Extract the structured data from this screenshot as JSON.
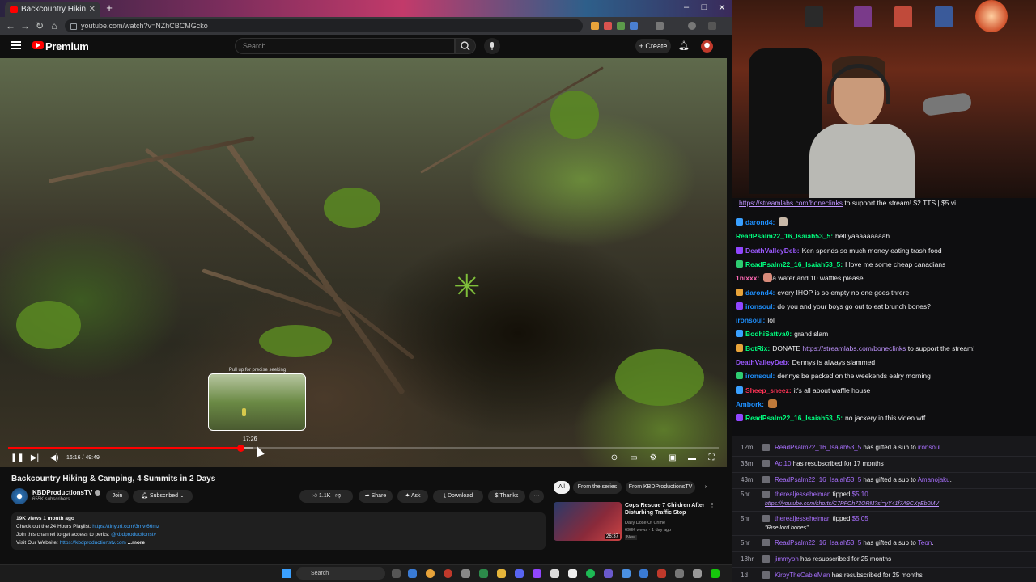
{
  "browser": {
    "tab_title": "Backcountry Hiking & Camp",
    "url": "youtube.com/watch?v=NZhCBCMGcko"
  },
  "youtube": {
    "brand": "Premium",
    "search_placeholder": "Search",
    "create_label": "Create",
    "video": {
      "hint": "Pull up for precise seeking",
      "preview_time": "17:26",
      "time_display": "16:16 / 49:49",
      "played_fraction": 0.327,
      "buffered_fraction": 0.345,
      "title": "Backcountry Hiking & Camping, 4 Summits in 2 Days"
    },
    "channel": {
      "name": "KBDProductionsTV",
      "subscribers": "655K subscribers",
      "join_label": "Join",
      "subscribed_label": "Subscribed"
    },
    "actions": {
      "likes": "1.1K",
      "share": "Share",
      "ask": "Ask",
      "download": "Download",
      "thanks": "Thanks",
      "more": "···"
    },
    "description": {
      "meta": "19K views  1 month ago",
      "line1_text": "Check out the 24 Hours Playlist: ",
      "line1_link": "https://tinyurl.com/3mvt66mz",
      "line2_text": "Join this channel to get access to perks: ",
      "line2_link": "@kbdproductionstv",
      "line3_text": "Visit Our Website: ",
      "line3_link": "https://kbdproductionstv.com",
      "more": "...more"
    },
    "filters": [
      "All",
      "From the series",
      "From KBDProductionsTV"
    ],
    "upnext": {
      "title": "Cops Rescue 7 Children After Disturbing Traffic Stop",
      "channel": "Daily Dose Of Crime",
      "meta": "698K views · 1 day ago",
      "badge": "New",
      "duration": "26:37"
    }
  },
  "taskbar": {
    "search_label": "Search"
  },
  "chat": {
    "banner_link": "https://streamlabs.com/boneclinks",
    "banner_text": " to support the stream! $2 TTS | $5 vi...",
    "messages": [
      {
        "user": "darond4:",
        "text": "",
        "color": "#1e90ff",
        "emote": "#c8b8a8"
      },
      {
        "user": "ReadPsalm22_16_Isaiah53_5:",
        "text": "hell yaaaaaaaaah",
        "color": "#00ff7f"
      },
      {
        "user": "DeathValleyDeb:",
        "text": "Ken spends so much money eating trash food",
        "color": "#9b59ff"
      },
      {
        "user": "ReadPsalm22_16_Isaiah53_5:",
        "text": "I love me some cheap canadians",
        "color": "#00ff7f"
      },
      {
        "user": "1nixxx:",
        "text": "a water and 10 waffles please",
        "color": "#ff69b4",
        "emote": "#d88a7a"
      },
      {
        "user": "darond4:",
        "text": "every IHOP is so empty no one goes threre",
        "color": "#1e90ff"
      },
      {
        "user": "ironsoul:",
        "text": "do you and your boys go out to eat brunch bones?",
        "color": "#1e90ff"
      },
      {
        "user": "ironsoul:",
        "text": "lol",
        "color": "#1e90ff"
      },
      {
        "user": "BodhiSattva0:",
        "text": "grand slam",
        "color": "#00ff7f"
      },
      {
        "user": "BotRix:",
        "text": "DONATE ",
        "link": "https://streamlabs.com/boneclinks",
        "after": " to support the stream!",
        "color": "#00ff7f"
      },
      {
        "user": "DeathValleyDeb:",
        "text": "Dennys is always slammed",
        "color": "#9b59ff"
      },
      {
        "user": "ironsoul:",
        "text": "dennys be packed on the weekends ealry morning",
        "color": "#1e90ff"
      },
      {
        "user": "Sheep_sneez:",
        "text": "it's all about waffle house",
        "color": "#ff3355"
      },
      {
        "user": "Ambork:",
        "text": "",
        "color": "#1e90ff",
        "emote": "#c07a3a"
      },
      {
        "user": "ReadPsalm22_16_Isaiah53_5:",
        "text": "no jackery in this video wtf",
        "color": "#00ff7f"
      }
    ]
  },
  "events": [
    {
      "time": "12m",
      "name": "ReadPsalm22_16_Isaiah53_5",
      "text": " has gifted a sub to ",
      "target": "ironsoul",
      "end": "."
    },
    {
      "time": "33m",
      "name": "Act10",
      "text": " has resubscribed for 17 months",
      "target": "",
      "end": ""
    },
    {
      "time": "43m",
      "name": "ReadPsalm22_16_Isaiah53_5",
      "text": " has gifted a sub to ",
      "target": "Amanojaku",
      "end": "."
    },
    {
      "time": "5hr",
      "name": "therealjesseheiman",
      "text": " tipped ",
      "target": "$5.10",
      "end": "",
      "sub": "https://youtube.com/shorts/C7PFOh73ORM?si=yY41f7A9CXyEb0MV",
      "sub_link": true
    },
    {
      "time": "5hr",
      "name": "therealjesseheiman",
      "text": " tipped ",
      "target": "$5.05",
      "end": "",
      "sub": "\"Rise lord bones\"",
      "sub_link": false
    },
    {
      "time": "5hr",
      "name": "ReadPsalm22_16_Isaiah53_5",
      "text": " has gifted a sub to ",
      "target": "Teon",
      "end": "."
    },
    {
      "time": "18hr",
      "name": "jimmyoh",
      "text": " has resubscribed for 25 months",
      "target": "",
      "end": ""
    },
    {
      "time": "1d",
      "name": "KirbyTheCableMan",
      "text": " has resubscribed for 25 months",
      "target": "",
      "end": ""
    }
  ],
  "colors": {
    "yt_red": "#ff0000",
    "twitch_purple": "#a970ff",
    "link_blue": "#3ea6ff"
  }
}
